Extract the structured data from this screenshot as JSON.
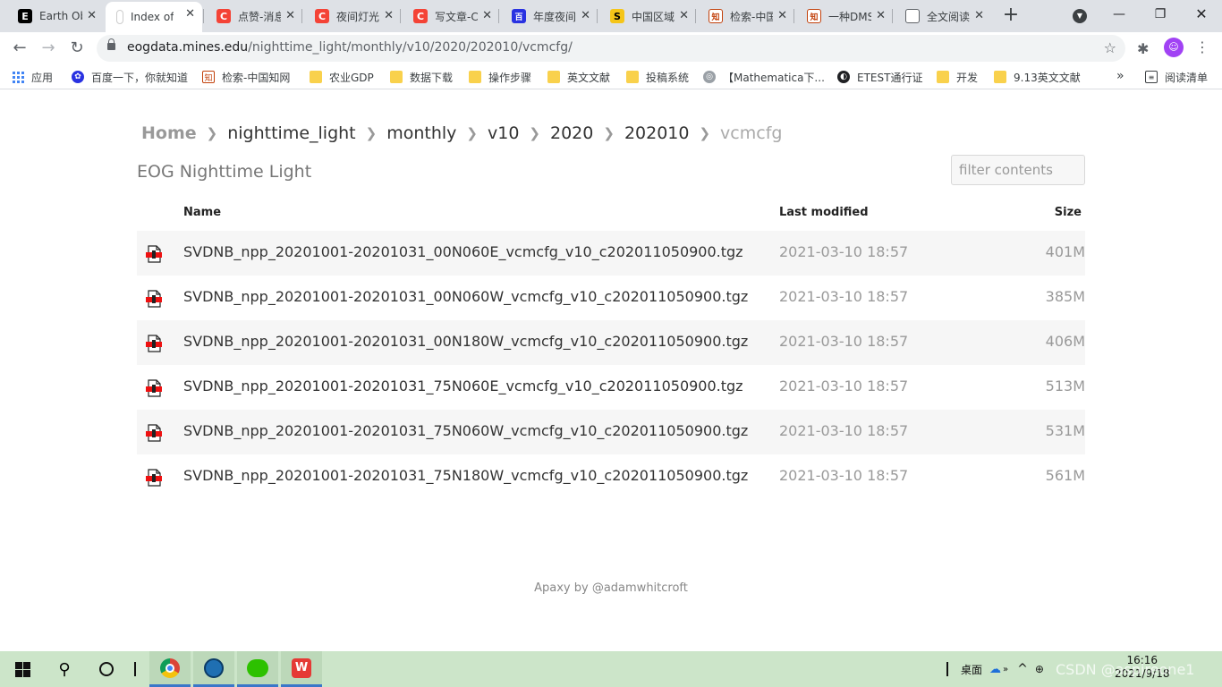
{
  "browser": {
    "tabs": [
      {
        "label": "Earth Ob",
        "icon": "E",
        "color": "#000000"
      },
      {
        "label": "Index of",
        "icon": "",
        "color": "#ffffff",
        "active": true
      },
      {
        "label": "点赞-消息",
        "icon": "C",
        "color": "#f44336"
      },
      {
        "label": "夜间灯光",
        "icon": "C",
        "color": "#f44336"
      },
      {
        "label": "写文章-C",
        "icon": "C",
        "color": "#f44336"
      },
      {
        "label": "年度夜间",
        "icon": "百",
        "color": "#2932e1"
      },
      {
        "label": "中国区域",
        "icon": "S",
        "color": "#f5c518"
      },
      {
        "label": "检索-中国",
        "icon": "知",
        "color": "#c2410c"
      },
      {
        "label": "一种DMS",
        "icon": "知",
        "color": "#c2410c"
      },
      {
        "label": "全文阅读",
        "icon": "文",
        "color": "#5f6368"
      }
    ],
    "url_host": "eogdata.mines.edu",
    "url_path": "/nighttime_light/monthly/v10/2020/202010/vcmcfg/",
    "bookmarks": [
      {
        "label": "应用",
        "kind": "apps"
      },
      {
        "label": "百度一下，你就知道",
        "kind": "baidu"
      },
      {
        "label": "检索-中国知网",
        "kind": "cnki"
      },
      {
        "label": "农业GDP",
        "kind": "folder"
      },
      {
        "label": "数据下载",
        "kind": "folder"
      },
      {
        "label": "操作步骤",
        "kind": "folder"
      },
      {
        "label": "英文文献",
        "kind": "folder"
      },
      {
        "label": "投稿系统",
        "kind": "folder"
      },
      {
        "label": "【Mathematica下...",
        "kind": "site"
      },
      {
        "label": "ETEST通行证",
        "kind": "site"
      },
      {
        "label": "开发",
        "kind": "folder"
      },
      {
        "label": "9.13英文文献",
        "kind": "folder"
      }
    ],
    "reading_list": "阅读清单"
  },
  "breadcrumb": {
    "home": "Home",
    "items": [
      "nighttime_light",
      "monthly",
      "v10",
      "2020",
      "202010"
    ],
    "current": "vcmcfg"
  },
  "page": {
    "title": "EOG Nighttime Light",
    "filter_placeholder": "filter contents",
    "footer": "Apaxy by @adamwhitcroft"
  },
  "table": {
    "headers": {
      "name": "Name",
      "modified": "Last modified",
      "size": "Size"
    },
    "rows": [
      {
        "name": "SVDNB_npp_20201001-20201031_00N060E_vcmcfg_v10_c202011050900.tgz",
        "modified": "2021-03-10 18:57",
        "size": "401M"
      },
      {
        "name": "SVDNB_npp_20201001-20201031_00N060W_vcmcfg_v10_c202011050900.tgz",
        "modified": "2021-03-10 18:57",
        "size": "385M"
      },
      {
        "name": "SVDNB_npp_20201001-20201031_00N180W_vcmcfg_v10_c202011050900.tgz",
        "modified": "2021-03-10 18:57",
        "size": "406M"
      },
      {
        "name": "SVDNB_npp_20201001-20201031_75N060E_vcmcfg_v10_c202011050900.tgz",
        "modified": "2021-03-10 18:57",
        "size": "513M"
      },
      {
        "name": "SVDNB_npp_20201001-20201031_75N060W_vcmcfg_v10_c202011050900.tgz",
        "modified": "2021-03-10 18:57",
        "size": "531M"
      },
      {
        "name": "SVDNB_npp_20201001-20201031_75N180W_vcmcfg_v10_c202011050900.tgz",
        "modified": "2021-03-10 18:57",
        "size": "561M"
      }
    ]
  },
  "taskbar": {
    "desktop_label": "桌面",
    "time": "16:16",
    "date": "2021/9/18",
    "watermark": "CSDN @aspireone1"
  }
}
